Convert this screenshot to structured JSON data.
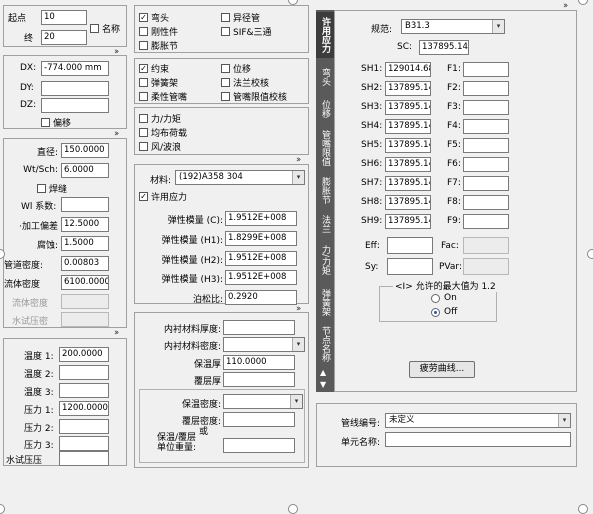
{
  "top": {
    "start_label": "起点",
    "start_value": "10",
    "end_label": "终",
    "end_value": "20",
    "name_label": "名称"
  },
  "offset": {
    "dx_label": "DX:",
    "dx_value": "-774.000 mm",
    "dy_label": "DY:",
    "dy_value": "",
    "dz_label": "DZ:",
    "dz_value": "",
    "offset_label": "偏移"
  },
  "pipe": {
    "diameter_label": "直径:",
    "diameter_value": "150.0000",
    "wt_label": "Wt/Sch:",
    "wt_value": "6.0000",
    "weld_label": "焊缝",
    "wl_label": "Wl 系数:",
    "wl_value": "",
    "allow_label": "·加工偏差",
    "allow_value": "12.5000",
    "corr_label": "腐蚀:",
    "corr_value": "1.5000",
    "pdens_label": "管道密度:",
    "pdens_value": "0.00803",
    "fdens_label": "流体密度",
    "fdens_value": "6100.0000",
    "fdens2_label": "流体密度",
    "fdens2_value": "",
    "hydro_label": "水试压密",
    "hydro_value": ""
  },
  "temps": {
    "t1_label": "温度 1:",
    "t1_value": "200.0000",
    "t2_label": "温度 2:",
    "t2_value": "",
    "t3_label": "温度 3:",
    "t3_value": "",
    "p1_label": "压力 1:",
    "p1_value": "1200.0000",
    "p2_label": "压力 2:",
    "p2_value": "",
    "p3_label": "压力 3:",
    "p3_value": "",
    "hp_label": "水试压压",
    "hp_value": ""
  },
  "elements": {
    "bend": "弯头",
    "rigid": "刚性件",
    "expansion": "膨胀节",
    "reducer": "异径管",
    "sif": "SIF&三通"
  },
  "restraints": {
    "restraint": "约束",
    "hanger": "弹簧架",
    "flex": "柔性管嘴",
    "displ": "位移",
    "flange": "法兰校核",
    "nozzle": "管嘴限值校核"
  },
  "loads": {
    "force": "力/力矩",
    "uniform": "均布荷载",
    "wind": "风/波浪"
  },
  "material": {
    "label": "材料:",
    "value": "(192)A358 304",
    "allow_label": "许用应力",
    "e_c_label": "弹性模量 (C):",
    "e_c_value": "1.9512E+008",
    "e_h1_label": "弹性模量 (H1):",
    "e_h1_value": "1.8299E+008",
    "e_h2_label": "弹性模量 (H2):",
    "e_h2_value": "1.9512E+008",
    "e_h3_label": "弹性模量 (H3):",
    "e_h3_value": "1.9512E+008",
    "poisson_label": "泊松比:",
    "poisson_value": "0.2920"
  },
  "lining": {
    "thick_label": "内衬材料厚度:",
    "thick_value": "",
    "dens_label": "内衬材料密度:",
    "dens_value": "",
    "ins_label": "保温厚",
    "ins_value": "110.0000",
    "clad_label": "覆层厚",
    "clad_value": "",
    "ins_dens_label": "保温密度:",
    "ins_dens_value": "",
    "clad_dens_label": "覆层密度:",
    "clad_dens_value": "",
    "or_label": "或",
    "unit_label": "保温/覆层\n单位重量:",
    "unit_value": ""
  },
  "tabs": [
    "许用应力",
    "弯头",
    "位移",
    "管嘴限值",
    "膨胀节",
    "法兰",
    "力/力矩",
    "弹簧架",
    "节点名称"
  ],
  "allowable": {
    "code_label": "规范:",
    "code_value": "B31.3",
    "sc_label": "SC:",
    "sc_value": "137895.14",
    "sh": [
      {
        "label": "SH1:",
        "value": "129014.68",
        "f_label": "F1:"
      },
      {
        "label": "SH2:",
        "value": "137895.14",
        "f_label": "F2:"
      },
      {
        "label": "SH3:",
        "value": "137895.14",
        "f_label": "F3:"
      },
      {
        "label": "SH4:",
        "value": "137895.14",
        "f_label": "F4:"
      },
      {
        "label": "SH5:",
        "value": "137895.14",
        "f_label": "F5:"
      },
      {
        "label": "SH6:",
        "value": "137895.14",
        "f_label": "F6:"
      },
      {
        "label": "SH7:",
        "value": "137895.14",
        "f_label": "F7:"
      },
      {
        "label": "SH8:",
        "value": "137895.14",
        "f_label": "F8:"
      },
      {
        "label": "SH9:",
        "value": "137895.14",
        "f_label": "F9:"
      }
    ],
    "eff_label": "Eff:",
    "fac_label": "Fac:",
    "sy_label": "Sy:",
    "pvar_label": "PVar:",
    "max_group_label": "<I> 允许的最大值为 1.2",
    "on_label": "On",
    "off_label": "Off",
    "fatigue_button": "疲劳曲线..."
  },
  "lineinfo": {
    "line_label": "管线编号:",
    "line_value": "未定义",
    "elem_label": "单元名称:",
    "elem_value": ""
  }
}
